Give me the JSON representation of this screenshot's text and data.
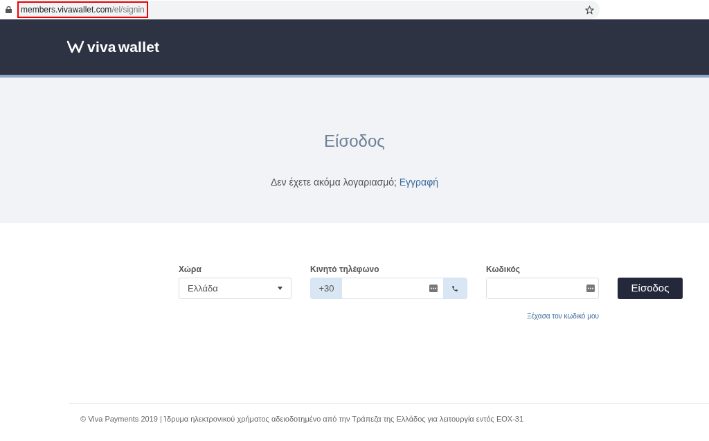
{
  "address_bar": {
    "host": "members.vivawallet.com",
    "path": "/el/signin",
    "highlighted": true
  },
  "logo": {
    "part_1": "viva",
    "part_2": "wallet"
  },
  "hero": {
    "title": "Είσοδος",
    "prompt": "Δεν έχετε ακόμα λογαριασμό;",
    "register_link": "Εγγραφή"
  },
  "form": {
    "country": {
      "label": "Χώρα",
      "value": "Ελλάδα"
    },
    "phone": {
      "label": "Κινητό τηλέφωνο",
      "prefix": "+30"
    },
    "password": {
      "label": "Κωδικός"
    },
    "forgot_link": "Ξέχασα τον κωδικό μου",
    "submit": "Είσοδος"
  },
  "footer": "© Viva Payments 2019 | Ίδρυμα ηλεκτρονικού χρήματος αδειοδοτημένο από την Τράπεζα της Ελλάδος για λειτουργία εντός ΕΟΧ-31"
}
